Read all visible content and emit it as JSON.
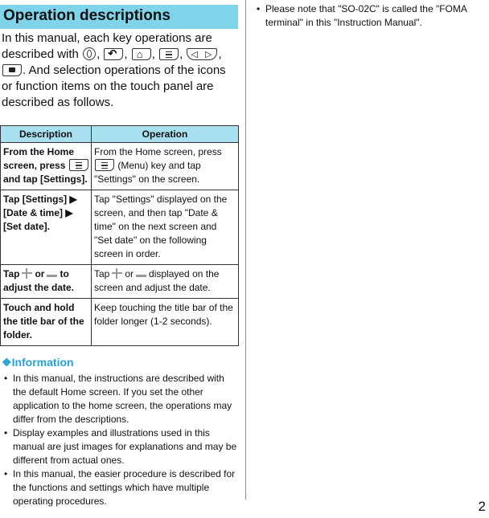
{
  "section": {
    "title": "Operation descriptions"
  },
  "intro": {
    "part1": "In this manual, each key operations are described with ",
    "sep": ", ",
    "part2": ". And selection operations of the icons or function items on the touch panel are described as follows.",
    "keys": [
      "power-key",
      "back-key",
      "home-key",
      "menu-key",
      "volume-key",
      "camera-key"
    ]
  },
  "table": {
    "headers": [
      "Description",
      "Operation"
    ],
    "rows": [
      {
        "desc_pre": "From the Home screen, press ",
        "desc_post": " and tap [Settings].",
        "op_pre": "From the Home screen, press ",
        "op_post": " (Menu) key and tap \"Settings\" on the screen."
      },
      {
        "desc": "Tap [Settings] ▶ [Date & time] ▶ [Set date].",
        "op": "Tap \"Settings\" displayed on the screen, and then tap \"Date & time\" on the next screen and \"Set date\" on the following screen in order."
      },
      {
        "desc_pre": "Tap",
        "desc_mid": "or",
        "desc_post": "to adjust the date.",
        "op_pre": "Tap",
        "op_mid": "or",
        "op_post": "displayed on the screen and adjust the date."
      },
      {
        "desc": "Touch and hold the title bar of the folder.",
        "op": "Keep touching the title bar of the folder longer (1-2 seconds)."
      }
    ]
  },
  "information": {
    "icon": "❖",
    "title": "Information",
    "items": [
      "In this manual, the instructions are described with the default Home screen. If you set the other application to the home screen, the operations may differ from the descriptions.",
      "Display examples and illustrations used in this manual are just images for explanations and may be different from actual ones.",
      "In this manual, the easier procedure is described for the functions and settings which have multiple operating procedures."
    ]
  },
  "right_column": {
    "items": [
      "Please note that \"SO-02C\" is called the \"FOMA terminal\" in this \"Instruction Manual\"."
    ]
  },
  "page_number": "2",
  "colors": {
    "title_bar": "#7fd4ea",
    "table_header": "#a8e0f0",
    "accent": "#27a3d2",
    "divider": "#2bb3d6"
  }
}
